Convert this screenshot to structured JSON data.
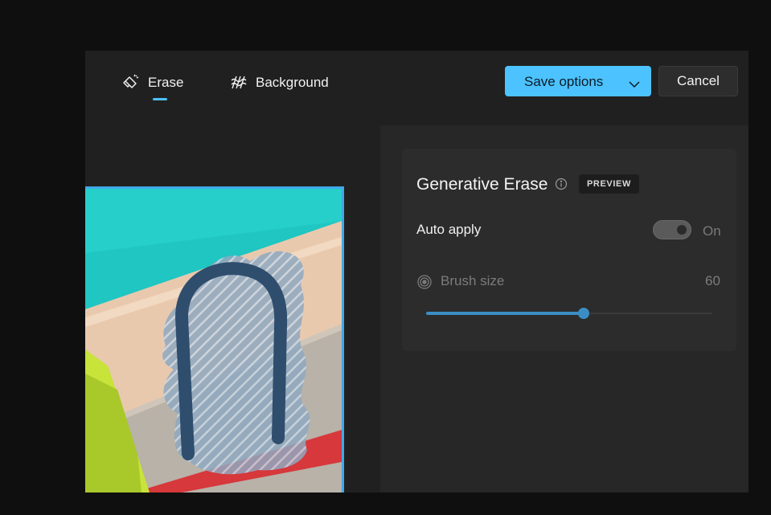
{
  "toolbar": {
    "tabs": [
      {
        "label": "Erase",
        "icon": "erase-icon",
        "active": true
      },
      {
        "label": "Background",
        "icon": "background-icon",
        "active": false
      }
    ],
    "save_label": "Save options",
    "cancel_label": "Cancel"
  },
  "panel": {
    "title": "Generative Erase",
    "badge": "PREVIEW",
    "auto_apply_label": "Auto apply",
    "auto_apply_state": "On",
    "brush_size_label": "Brush size",
    "brush_size_value": "60",
    "brush_size_fraction": 0.55
  },
  "colors": {
    "accent": "#4cc2ff",
    "slider": "#3b8ec4",
    "panel_bg": "#272727",
    "window_bg": "#202020"
  }
}
